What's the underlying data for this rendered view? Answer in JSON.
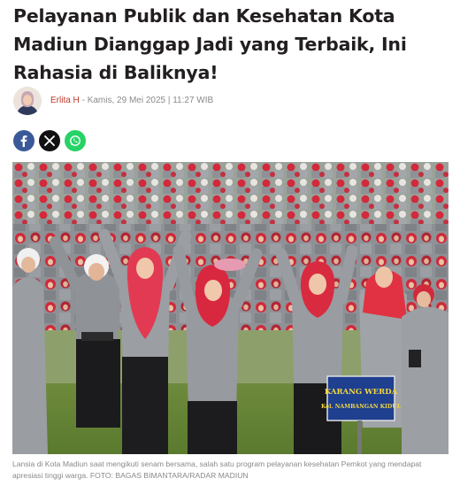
{
  "article": {
    "title": "Pelayanan Publik dan Kesehatan Kota Madiun Dianggap Jadi yang Terbaik, Ini Rahasia di Baliknya!",
    "author": "Erlita H",
    "separator": "-",
    "date": "Kamis, 29 Mei 2025 | 11:27 WIB"
  },
  "share": {
    "facebook_icon": "facebook-icon",
    "x_icon": "x-icon",
    "whatsapp_icon": "whatsapp-icon",
    "facebook_label": "f",
    "x_label": "𝕏"
  },
  "photo": {
    "sign_line1": "KARANG WERDA",
    "sign_line2": "Kel. NAMBANGAN KIDUL"
  },
  "caption": "Lansia di Kota Madiun saat mengikuti senam bersama, salah satu program pelayanan kesehatan Pemkot yang mendapat apresiasi tinggi warga. FOTO: BAGAS BIMANTARA/RADAR MADIUN",
  "colors": {
    "author": "#c0392b",
    "facebook": "#3b5998",
    "x": "#111111",
    "whatsapp": "#25d366",
    "hijab_red": "#d22a3c",
    "uniform_grey": "#8e9196"
  }
}
